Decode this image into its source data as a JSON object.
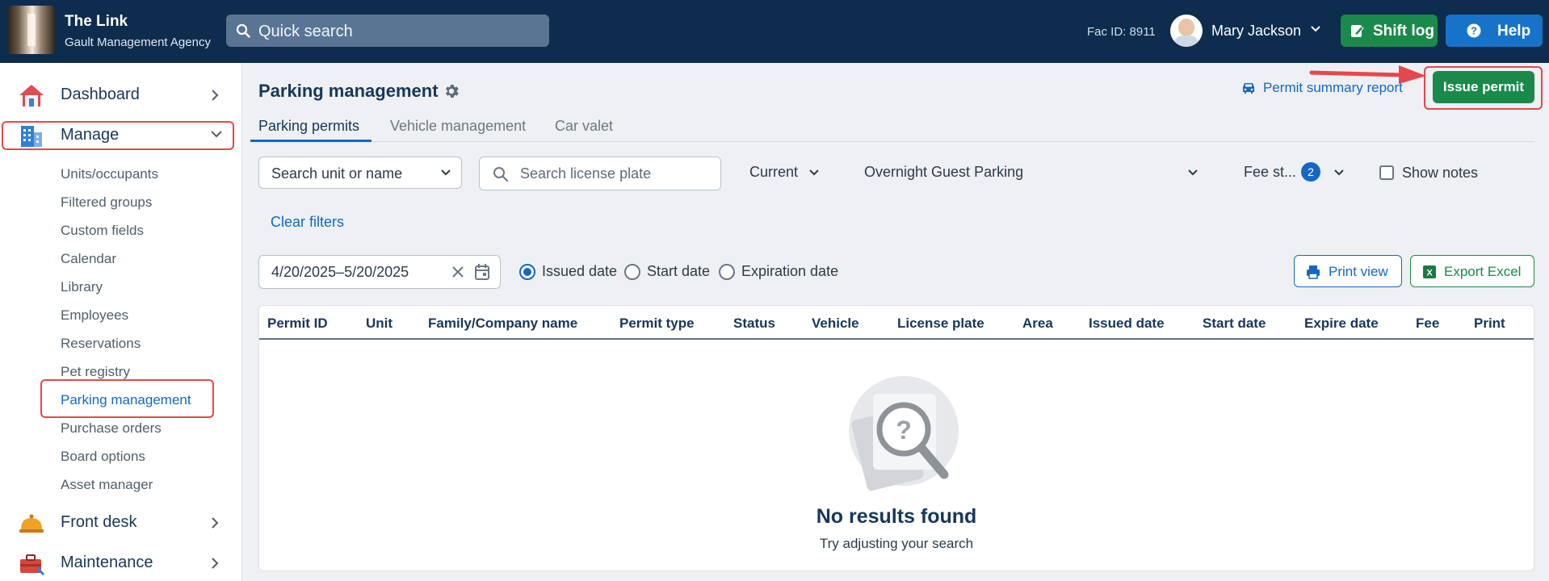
{
  "header": {
    "brand_name": "The Link",
    "brand_sub": "Gault Management Agency",
    "search_placeholder": "Quick search",
    "fac_id": "Fac ID: 8911",
    "user_name": "Mary Jackson",
    "shift_log_label": "Shift log",
    "help_label": "Help"
  },
  "sidebar": {
    "items": [
      {
        "label": "Dashboard",
        "icon": "house-icon"
      },
      {
        "label": "Manage",
        "icon": "building-icon",
        "expanded": true
      },
      {
        "label": "Front desk",
        "icon": "bell-icon"
      },
      {
        "label": "Maintenance",
        "icon": "toolbox-icon"
      }
    ],
    "manage_subitems": [
      "Units/occupants",
      "Filtered groups",
      "Custom fields",
      "Calendar",
      "Library",
      "Employees",
      "Reservations",
      "Pet registry",
      "Parking management",
      "Purchase orders",
      "Board options",
      "Asset manager"
    ],
    "active_subitem": "Parking management"
  },
  "main": {
    "title": "Parking management",
    "permit_summary_label": "Permit summary report",
    "issue_permit_label": "Issue permit",
    "tabs": [
      "Parking permits",
      "Vehicle management",
      "Car valet"
    ],
    "active_tab": "Parking permits",
    "filters": {
      "unit_select": "Search unit or name",
      "plate_placeholder": "Search license plate",
      "status_select": "Current",
      "area_select": "Overnight Guest Parking",
      "fee_status_label": "Fee st...",
      "fee_status_count": "2",
      "show_notes_label": "Show notes",
      "show_notes_checked": false,
      "clear_filters_label": "Clear filters",
      "date_range": "4/20/2025–5/20/2025",
      "date_types": [
        "Issued date",
        "Start date",
        "Expiration date"
      ],
      "selected_date_type": "Issued date"
    },
    "print_view_label": "Print view",
    "export_excel_label": "Export Excel",
    "table": {
      "columns": [
        "Permit ID",
        "Unit",
        "Family/Company name",
        "Permit type",
        "Status",
        "Vehicle",
        "License plate",
        "Area",
        "Issued date",
        "Start date",
        "Expire date",
        "Fee",
        "Print"
      ],
      "rows": []
    },
    "empty_state": {
      "title": "No results found",
      "subtitle": "Try adjusting your search"
    }
  },
  "colors": {
    "topbar": "#0e2c4e",
    "accent_blue": "#1468c2",
    "green_button": "#1a8a4b",
    "highlight_red": "#e4484d"
  }
}
